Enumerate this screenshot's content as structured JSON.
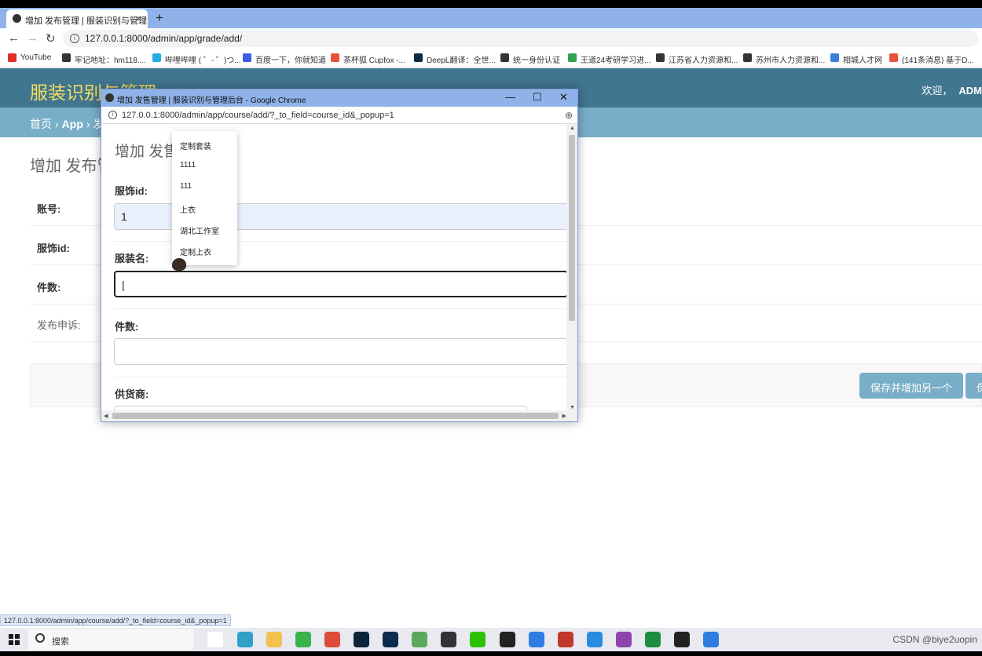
{
  "browser": {
    "tab_title": "增加 发布管理 | 服装识别与管理...",
    "tab_close": "×",
    "new_tab": "+",
    "url": "127.0.0.1:8000/admin/app/grade/add/",
    "bookmarks": [
      {
        "label": "YouTube",
        "color": "#e52d27"
      },
      {
        "label": "牢记地址：hm118....",
        "color": "#333333"
      },
      {
        "label": "哔哩哔哩 ( ゜- ゜)つ...",
        "color": "#23ade5"
      },
      {
        "label": "百度一下，你就知道",
        "color": "#3b5ee8"
      },
      {
        "label": "茶杯狐 Cupfox -...",
        "color": "#e8523b"
      },
      {
        "label": "DeepL翻译：全世...",
        "color": "#0f2b46"
      },
      {
        "label": "统一身份认证",
        "color": "#333333"
      },
      {
        "label": "王道24考研学习进...",
        "color": "#2ea44f"
      },
      {
        "label": "江苏省人力资源和...",
        "color": "#333333"
      },
      {
        "label": "苏州市人力资源和...",
        "color": "#333333"
      },
      {
        "label": "相城人才网",
        "color": "#3b7fd6"
      },
      {
        "label": "(141条消息) 基于D...",
        "color": "#e8523b"
      }
    ]
  },
  "admin": {
    "site_title": "服装识别与管理",
    "welcome": "欢迎，",
    "username": "ADM",
    "breadcrumbs": [
      "首页",
      "›",
      "App",
      "›",
      "发布"
    ],
    "page_heading": "增加 发布管",
    "fields": [
      "账号:",
      "服饰id:",
      "件数:",
      "发布申诉:"
    ],
    "buttons": [
      "保存并增加另一个",
      "保"
    ]
  },
  "popup": {
    "title": "增加 发售管理 | 服装识别与管理后台 - Google Chrome",
    "minimize": "—",
    "maximize": "☐",
    "close": "✕",
    "url": "127.0.0.1:8000/admin/app/course/add/?_to_field=course_id&_popup=1",
    "heading": "增加 发售",
    "field1_label": "服饰id:",
    "field1_value": "1",
    "field2_label": "服装名:",
    "field3_label": "件数:",
    "field4_label": "供货商:"
  },
  "dropdown": {
    "options": [
      "定制套装",
      "1111",
      "111",
      "上衣",
      "湖北工作室",
      "定制上衣"
    ]
  },
  "status_url": "127.0.0.1:8000/admin/app/course/add/?_to_field=course_id&_popup=1",
  "taskbar": {
    "search_label": "搜索",
    "watermark": "CSDN @biye2uopin"
  },
  "colors": {
    "header": "#417690",
    "breadcrumb": "#79aec8",
    "site_title": "#f5dd5d",
    "button": "#79aec8"
  }
}
